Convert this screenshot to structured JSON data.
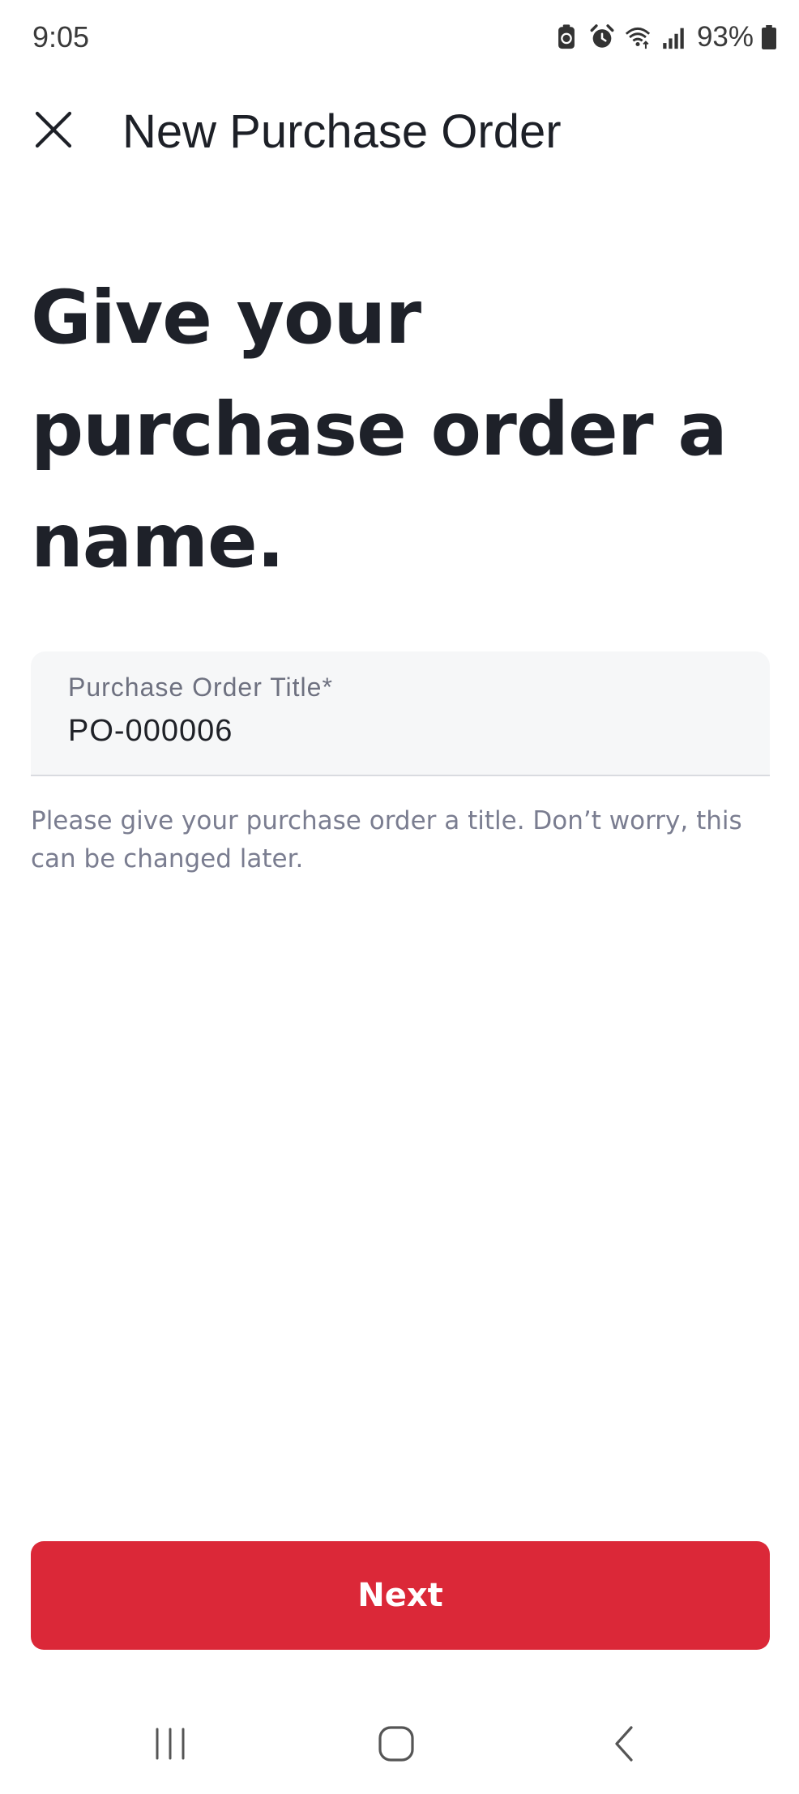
{
  "status_bar": {
    "time": "9:05",
    "battery_percent": "93%",
    "icons": [
      "battery-saver-icon",
      "alarm-icon",
      "wifi-icon",
      "signal-icon",
      "battery-icon"
    ]
  },
  "app_bar": {
    "title": "New Purchase Order",
    "close_icon": "close-icon"
  },
  "headline": "Give your purchase order a name.",
  "form": {
    "title_field": {
      "label": "Purchase Order Title*",
      "value": "PO-000006"
    },
    "helper_text": "Please give your purchase order a title. Don’t worry, this can be changed later."
  },
  "next_button": {
    "label": "Next"
  },
  "nav_bar": {
    "icons": [
      "recents-icon",
      "home-icon",
      "back-icon"
    ]
  },
  "colors": {
    "accent": "#db2838",
    "heading": "#1e2129",
    "helper": "#7a7d90",
    "field_bg": "#f6f7f8"
  }
}
